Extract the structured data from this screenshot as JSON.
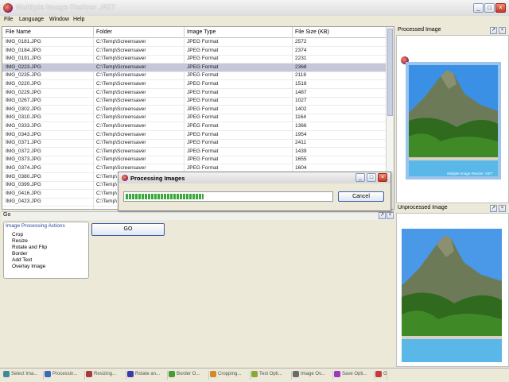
{
  "window": {
    "title": "Multiple Image Resizer .NET"
  },
  "menu": [
    "File",
    "Language",
    "Window",
    "Help"
  ],
  "grid": {
    "columns": [
      "File Name",
      "Folder",
      "Image Type",
      "File Size (KB)"
    ],
    "rows": [
      [
        "IMG_0181.JPG",
        "C:\\Temp\\Screensaver",
        "JPEG Format",
        "2572"
      ],
      [
        "IMG_0184.JPG",
        "C:\\Temp\\Screensaver",
        "JPEG Format",
        "2374"
      ],
      [
        "IMG_0191.JPG",
        "C:\\Temp\\Screensaver",
        "JPEG Format",
        "2231"
      ],
      [
        "IMG_0223.JPG",
        "C:\\Temp\\Screensaver",
        "JPEG Format",
        "2368"
      ],
      [
        "IMG_0235.JPG",
        "C:\\Temp\\Screensaver",
        "JPEG Format",
        "2118"
      ],
      [
        "IMG_0220.JPG",
        "C:\\Temp\\Screensaver",
        "JPEG Format",
        "1518"
      ],
      [
        "IMG_0229.JPG",
        "C:\\Temp\\Screensaver",
        "JPEG Format",
        "1487"
      ],
      [
        "IMG_0267.JPG",
        "C:\\Temp\\Screensaver",
        "JPEG Format",
        "1027"
      ],
      [
        "IMG_0302.JPG",
        "C:\\Temp\\Screensaver",
        "JPEG Format",
        "1402"
      ],
      [
        "IMG_0310.JPG",
        "C:\\Temp\\Screensaver",
        "JPEG Format",
        "1164"
      ],
      [
        "IMG_0333.JPG",
        "C:\\Temp\\Screensaver",
        "JPEG Format",
        "1366"
      ],
      [
        "IMG_0343.JPG",
        "C:\\Temp\\Screensaver",
        "JPEG Format",
        "1954"
      ],
      [
        "IMG_0371.JPG",
        "C:\\Temp\\Screensaver",
        "JPEG Format",
        "2411"
      ],
      [
        "IMG_0372.JPG",
        "C:\\Temp\\Screensaver",
        "JPEG Format",
        "1439"
      ],
      [
        "IMG_0373.JPG",
        "C:\\Temp\\Screensaver",
        "JPEG Format",
        "1655"
      ],
      [
        "IMG_0374.JPG",
        "C:\\Temp\\Screensaver",
        "JPEG Format",
        "1604"
      ],
      [
        "IMG_0380.JPG",
        "C:\\Temp\\",
        "",
        ""
      ],
      [
        "IMG_0399.JPG",
        "C:\\Temp\\",
        "",
        ""
      ],
      [
        "IMG_0416.JPG",
        "C:\\Temp\\",
        "",
        ""
      ],
      [
        "IMG_0423.JPG",
        "C:\\Temp\\",
        "",
        ""
      ]
    ],
    "selected_index": 3
  },
  "panels": {
    "processed": {
      "title": "Processed Image",
      "watermark": "Multiple Image Resizer .NET"
    },
    "unprocessed": {
      "title": "Unprocessed Image"
    }
  },
  "go_bar": {
    "label": "Go"
  },
  "actions": {
    "title": "Image Processing Actions",
    "items": [
      "Crop",
      "Resize",
      "Rotate and Flip",
      "Border",
      "Add Text",
      "Overlay Image"
    ]
  },
  "go_button": {
    "label": "GO"
  },
  "dialog": {
    "title": "Processing Images",
    "cancel_label": "Cancel",
    "progress": 0.38
  },
  "taskbar": [
    {
      "label": "Select Ima...",
      "icon": "select-icon",
      "color": "#3a8a9a"
    },
    {
      "label": "Processin...",
      "icon": "processing-icon",
      "color": "#3a6ab8"
    },
    {
      "label": "Resizing...",
      "icon": "resize-icon",
      "color": "#a83a3a"
    },
    {
      "label": "Rotate an...",
      "icon": "rotate-icon",
      "color": "#3a3aa8"
    },
    {
      "label": "Border O...",
      "icon": "border-icon",
      "color": "#4a9a3a"
    },
    {
      "label": "Cropping...",
      "icon": "crop-icon",
      "color": "#d08a2a"
    },
    {
      "label": "Text Opti...",
      "icon": "text-icon",
      "color": "#8aa83a"
    },
    {
      "label": "Image Ov...",
      "icon": "overlay-icon",
      "color": "#6a6a6a"
    },
    {
      "label": "Save Opti...",
      "icon": "save-icon",
      "color": "#9a3ab8"
    },
    {
      "label": "Go",
      "icon": "go-icon",
      "color": "#c83a3a"
    }
  ]
}
